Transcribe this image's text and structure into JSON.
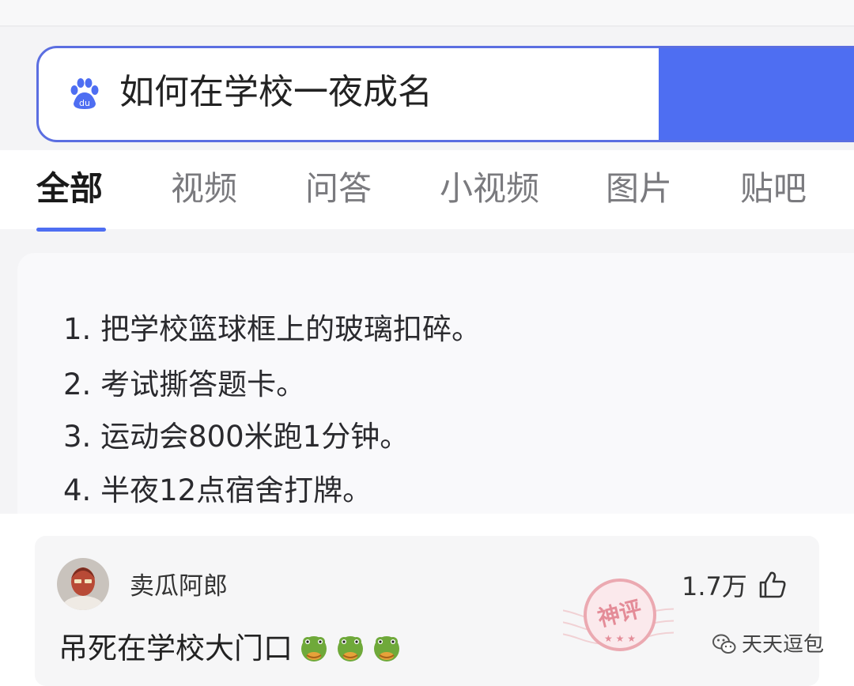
{
  "search": {
    "query": "如何在学校一夜成名"
  },
  "tabs": [
    {
      "label": "全部",
      "active": true
    },
    {
      "label": "视频"
    },
    {
      "label": "问答"
    },
    {
      "label": "小视频"
    },
    {
      "label": "图片"
    },
    {
      "label": "贴吧"
    }
  ],
  "answers": [
    "1. 把学校篮球框上的玻璃扣碎。",
    "2. 考试撕答题卡。",
    "3. 运动会800米跑1分钟。",
    "4. 半夜12点宿舍打牌。"
  ],
  "comment": {
    "username": "卖瓜阿郎",
    "likes": "1.7万",
    "text": "吊死在学校大门口",
    "emoji_count": 3,
    "stamp_text": "神评"
  },
  "watermark": {
    "text": "天天逗包"
  },
  "colors": {
    "accent": "#4e6ef2",
    "stamp": "#e9a0a8"
  }
}
